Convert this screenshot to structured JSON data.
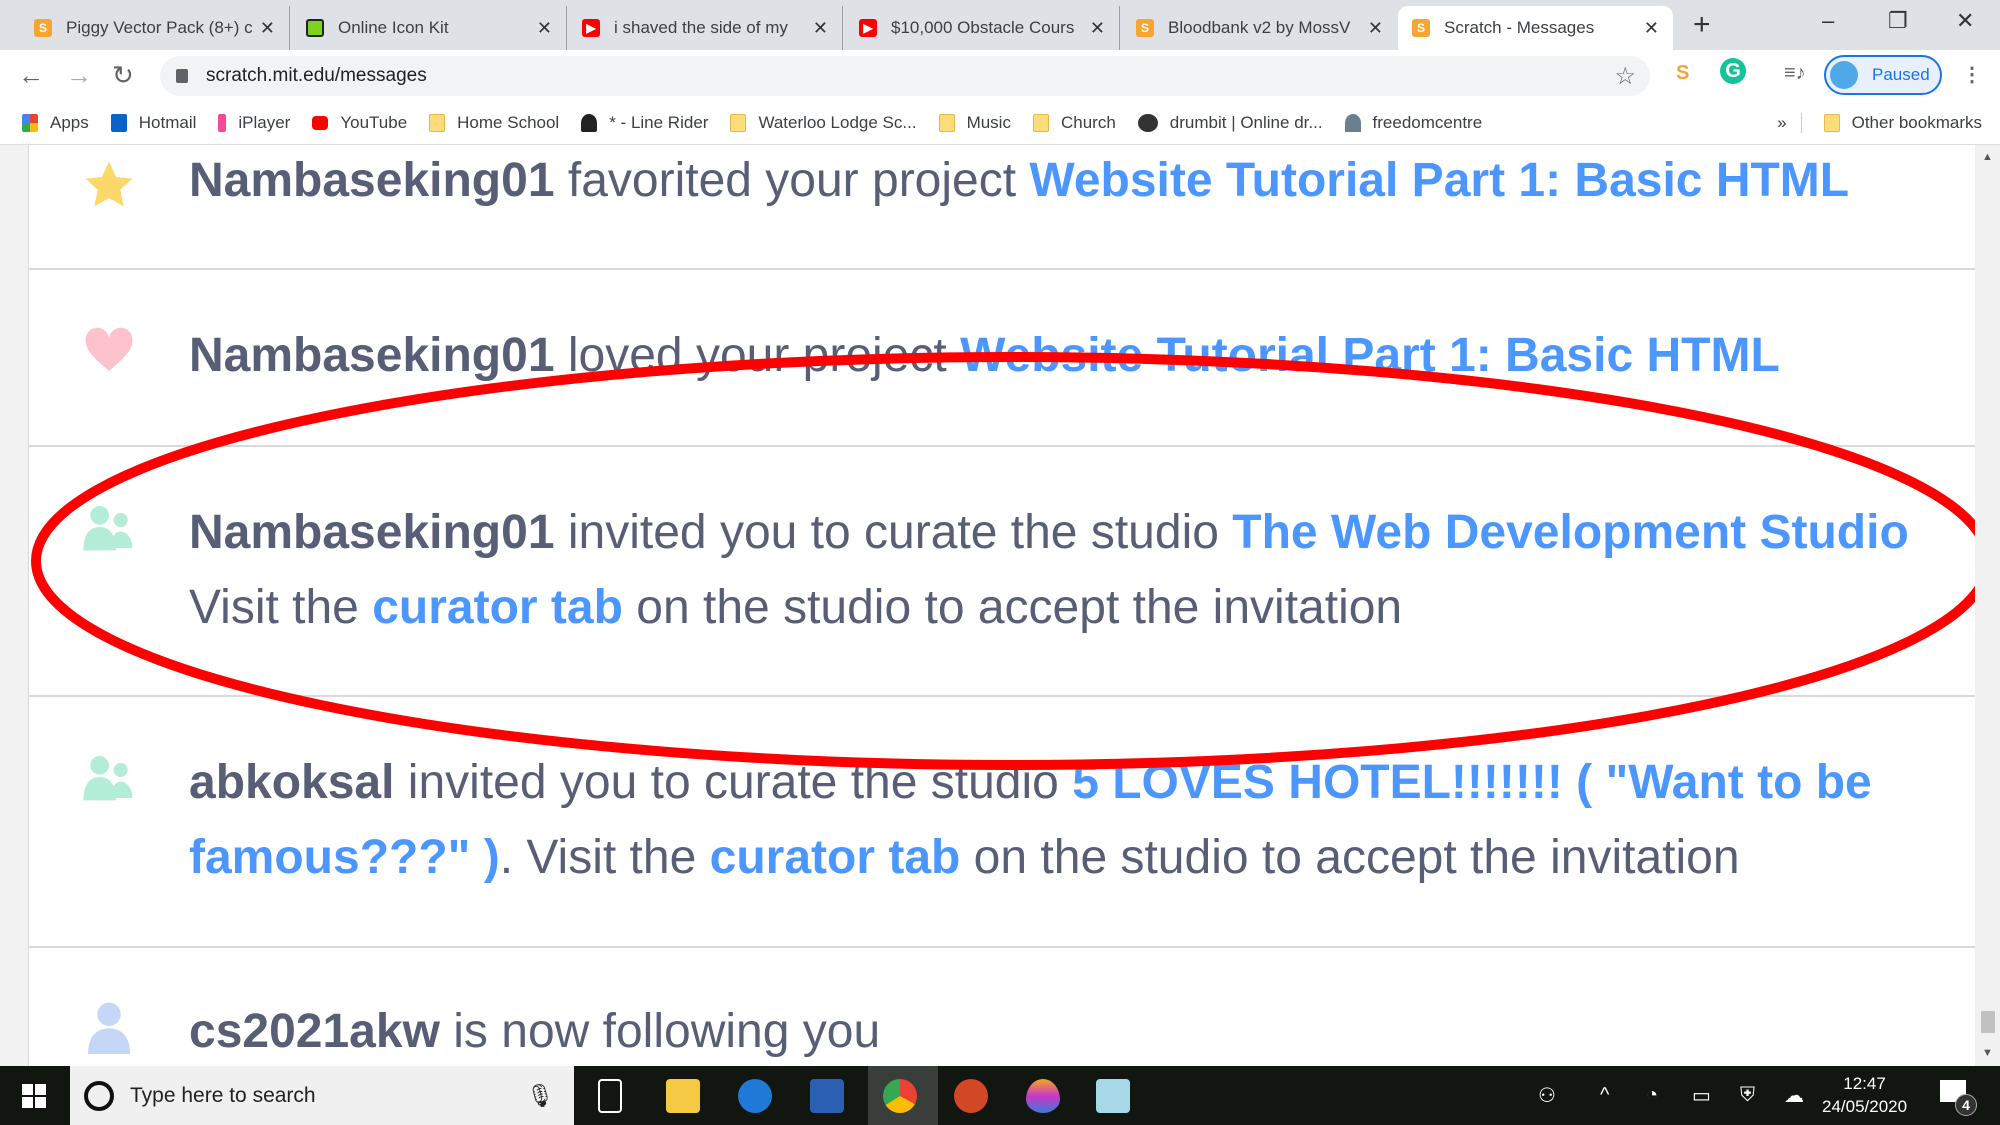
{
  "browser": {
    "tabs": [
      {
        "title": "Piggy Vector Pack (8+) c",
        "icon": "scratch-icon",
        "color": "#f7a531"
      },
      {
        "title": "Online Icon Kit",
        "icon": "icon-kit-icon",
        "color": "#7ed321"
      },
      {
        "title": "i shaved the side of my",
        "icon": "youtube-icon",
        "color": "#ff0000"
      },
      {
        "title": "$10,000 Obstacle Cours",
        "icon": "youtube-icon",
        "color": "#ff0000"
      },
      {
        "title": "Bloodbank v2 by MossV",
        "icon": "scratch-icon",
        "color": "#f7a531"
      },
      {
        "title": "Scratch - Messages",
        "icon": "scratch-icon",
        "color": "#f7a531",
        "active": true
      }
    ],
    "url": "scratch.mit.edu/messages",
    "profile_status": "Paused",
    "bookmarks": [
      {
        "label": "Apps",
        "icon": "apps-grid-icon"
      },
      {
        "label": "Hotmail",
        "icon": "outlook-icon"
      },
      {
        "label": "iPlayer",
        "icon": "iplayer-icon"
      },
      {
        "label": "YouTube",
        "icon": "youtube-icon"
      },
      {
        "label": "Home School",
        "icon": "folder-icon"
      },
      {
        "label": "* - Line Rider",
        "icon": "line-rider-icon"
      },
      {
        "label": "Waterloo Lodge Sc...",
        "icon": "folder-icon"
      },
      {
        "label": "Music",
        "icon": "folder-icon"
      },
      {
        "label": "Church",
        "icon": "folder-icon"
      },
      {
        "label": "drumbit | Online dr...",
        "icon": "drumbit-icon"
      },
      {
        "label": "freedomcentre",
        "icon": "freedomcentre-icon"
      }
    ],
    "overflow": "»",
    "other_bookmarks": "Other bookmarks"
  },
  "messages": [
    {
      "type": "favorite",
      "icon": "star-icon",
      "user": "Nambaseking01",
      "text": " favorited your project ",
      "link": "Website Tutorial Part 1: Basic HTML"
    },
    {
      "type": "love",
      "icon": "heart-icon",
      "user": "Nambaseking01",
      "text": " loved your project ",
      "link": "Website Tutorial Part 1: Basic HTML"
    },
    {
      "type": "curator-invite",
      "icon": "curators-icon",
      "user": "Nambaseking01",
      "text": " invited you to curate the studio ",
      "link": "The Web Development Studio",
      "text2": "Visit the ",
      "link2": "curator tab",
      "text3": " on the studio to accept the invitation"
    },
    {
      "type": "curator-invite",
      "icon": "curators-icon",
      "user": "abkoksal",
      "text": " invited you to curate the studio ",
      "link": "5 LOVES HOTEL!!!!!!! ( \"Want to be famous???\" )",
      "text2": ". Visit the ",
      "link2": "curator tab",
      "text3": " on the studio to accept the invitation"
    },
    {
      "type": "follow",
      "icon": "user-icon",
      "user": "cs2021akw",
      "text": " is now following you"
    }
  ],
  "annotation_color": "#ff0000",
  "taskbar": {
    "search_placeholder": "Type here to search",
    "time": "12:47",
    "date": "24/05/2020",
    "notifications": "4"
  }
}
